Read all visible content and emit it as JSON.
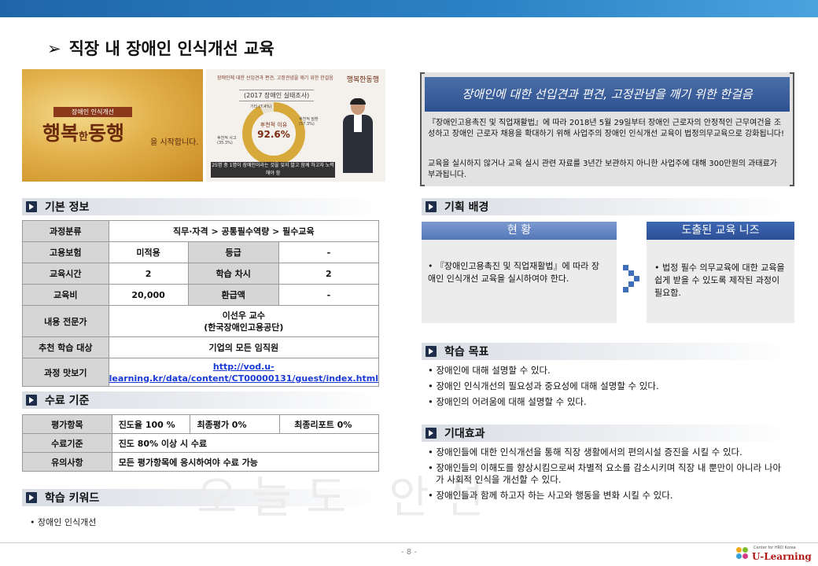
{
  "page": {
    "title": "직장 내 장애인 인식개선 교육",
    "page_number": "- 8 -",
    "watermark": "오늘도 안전"
  },
  "images": {
    "poster": {
      "tag": "장애인 인식개선",
      "headline_a": "행복",
      "headline_b": "한",
      "headline_c": "동행",
      "headline_d": "을 시작합니다."
    },
    "lecture": {
      "header": "장애인에 대한 선입견과 편견, 고정관념을 깨기 위한 한걸음",
      "logo": "행복한동행",
      "survey_title": "(2017 장애인 실태조사)",
      "donut_label": "후천적 이유",
      "donut_value": "92.6%",
      "label_other": "기타 (7.4%)",
      "label_disease": "후천적 질환 (57.3%)",
      "label_accident": "후천적 사고 (35.3%)",
      "banner": "25명 중 1명이 장애인이라는 것을 잊지 말고 함께 하고자 노력해야 함"
    }
  },
  "sections": {
    "basic_info": "기본 정보",
    "completion": "수료 기준",
    "keywords": "학습 키워드",
    "background": "기획 배경",
    "goals": "학습 목표",
    "effects": "기대효과"
  },
  "basic_info": {
    "category_label": "과정분류",
    "category_value": "직무·자격 > 공통필수역량 > 필수교육",
    "insurance_label": "고용보험",
    "insurance_value": "미적용",
    "grade_label": "등급",
    "grade_value": "-",
    "hours_label": "교육시간",
    "hours_value": "2",
    "sessions_label": "학습 차시",
    "sessions_value": "2",
    "fee_label": "교육비",
    "fee_value": "20,000",
    "refund_label": "환급액",
    "refund_value": "-",
    "expert_label": "내용 전문가",
    "expert_name": "이선우 교수",
    "expert_org": "(한국장애인고용공단)",
    "target_label": "추천 학습 대상",
    "target_value": "기업의 모든 임직원",
    "preview_label": "과정 맛보기",
    "preview_url_a": "http://vod.u-",
    "preview_url_b": "learning.kr/data/content/CT00000131/guest/index.html"
  },
  "completion": {
    "items_label": "평가항목",
    "progress": "진도율   100 %",
    "final_eval": "최종평가      0%",
    "final_report": "최종리포트       0%",
    "criteria_label": "수료기준",
    "criteria_value": "진도 80% 이상 시 수료",
    "notes_label": "유의사항",
    "notes_value": "모든 평가항목에 응시하여야 수료 가능"
  },
  "keywords": {
    "item": "• 장애인 인식개선"
  },
  "quote": {
    "headline": "장애인에 대한 선입견과 편견, 고정관념을 깨기 위한 한걸음",
    "p1": "『장애인고용촉진 및 직업재활법』에 따라 2018년 5월 29일부터 장애인 근로자의 안정적인 근무여건을 조성하고 장애인 근로자 채용을 확대하기 위해 사업주의 장애인 인식개선 교육이 법정의무교육으로 강화됩니다!",
    "p2": "교육을 실시하지 않거나 교육 실시 관련 자료를 3년간 보관하지 아니한 사업주에 대해 300만원의 과태료가 부과됩니다."
  },
  "background": {
    "status_title": "현 황",
    "status_body": "• 『장애인고용촉진 및 직업재활법』에 따라 장애인 인식개선 교육을 실시하여야 한다.",
    "needs_title": "도출된 교육 니즈",
    "needs_body": "• 법정 필수 의무교육에 대한 교육을 쉽게 받을 수 있도록 제작된 과정이 필요함."
  },
  "goals": [
    "• 장애인에 대해 설명할 수 있다.",
    "• 장애인 인식개선의 필요성과 중요성에 대해 설명할 수 있다.",
    "• 장애인의 어려움에 대해 설명할 수 있다."
  ],
  "effects": [
    "• 장애인들에 대한 인식개선을 통해 직장 생활에서의 편의시설 증진을 시킬 수 있다.",
    "• 장애인들의 이해도를 향상시킴으로써 차별적 요소를 감소시키며 직장 내 뿐만이 아니라 나아가 사회적 인식을 개선할 수 있다.",
    "• 장애인들과 함께 하고자 하는 사고와 행동을 변화 시킬 수 있다."
  ],
  "brand": {
    "small": "Center for HRD Korea",
    "name": "U-Learning"
  },
  "colors": {
    "accent": "#2b82c6",
    "heading_box": "#1d2d4a",
    "card_light": "#5477b8",
    "card_dark": "#2c4f96",
    "brand": "#b01818"
  }
}
